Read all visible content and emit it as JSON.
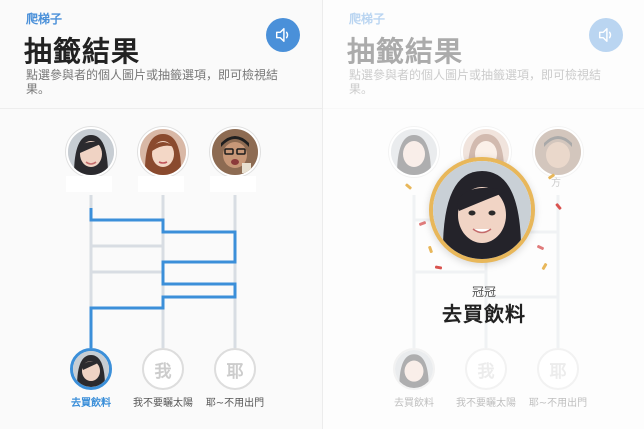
{
  "app": {
    "name": "爬梯子"
  },
  "header": {
    "title": "抽籤結果",
    "description": "點選參與者的個人圖片或抽籤選項，即可檢視結果。"
  },
  "players": [
    {
      "name": ""
    },
    {
      "name": ""
    },
    {
      "name": ""
    }
  ],
  "options": [
    {
      "glyph": "",
      "label": "去買飲料",
      "selected": true
    },
    {
      "glyph": "我",
      "label": "我不要曬太陽",
      "selected": false
    },
    {
      "glyph": "耶",
      "label": "耶~不用出門",
      "selected": false
    }
  ],
  "result": {
    "winner_name": "冠冠",
    "winner_choice": "去買飲料",
    "faded_player_label": "方"
  },
  "colors": {
    "accent": "#4a90d9",
    "path_highlight": "#3b8fd9",
    "ladder_line": "#d8dde3",
    "winner_ring": "#e8b75a"
  },
  "icons": {
    "sound": "speaker-icon"
  }
}
